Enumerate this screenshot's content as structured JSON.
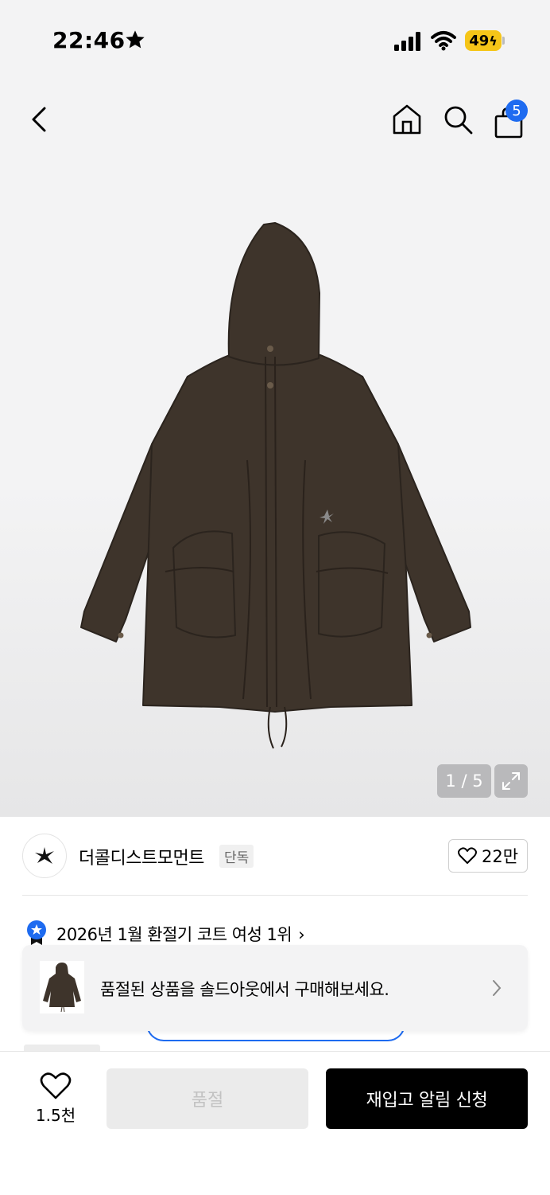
{
  "status_bar": {
    "time": "22:46",
    "battery": "49"
  },
  "nav": {
    "cart_count": "5"
  },
  "gallery": {
    "counter": "1 / 5"
  },
  "brand": {
    "name": "더콜디스트모먼트",
    "tag": "단독",
    "likes": "22만"
  },
  "ranking": {
    "text": "2026년 1월 환절기 코트 여성 1위"
  },
  "soldout_card": {
    "text": "품절된 상품을 솔드아웃에서 구매해보세요."
  },
  "bottom_bar": {
    "wish_count": "1.5천",
    "soldout_label": "품절",
    "restock_label": "재입고 알림 신청"
  },
  "colors": {
    "accent": "#1e6bf0",
    "battery": "#f5c518",
    "jacket": "#3e342b"
  }
}
